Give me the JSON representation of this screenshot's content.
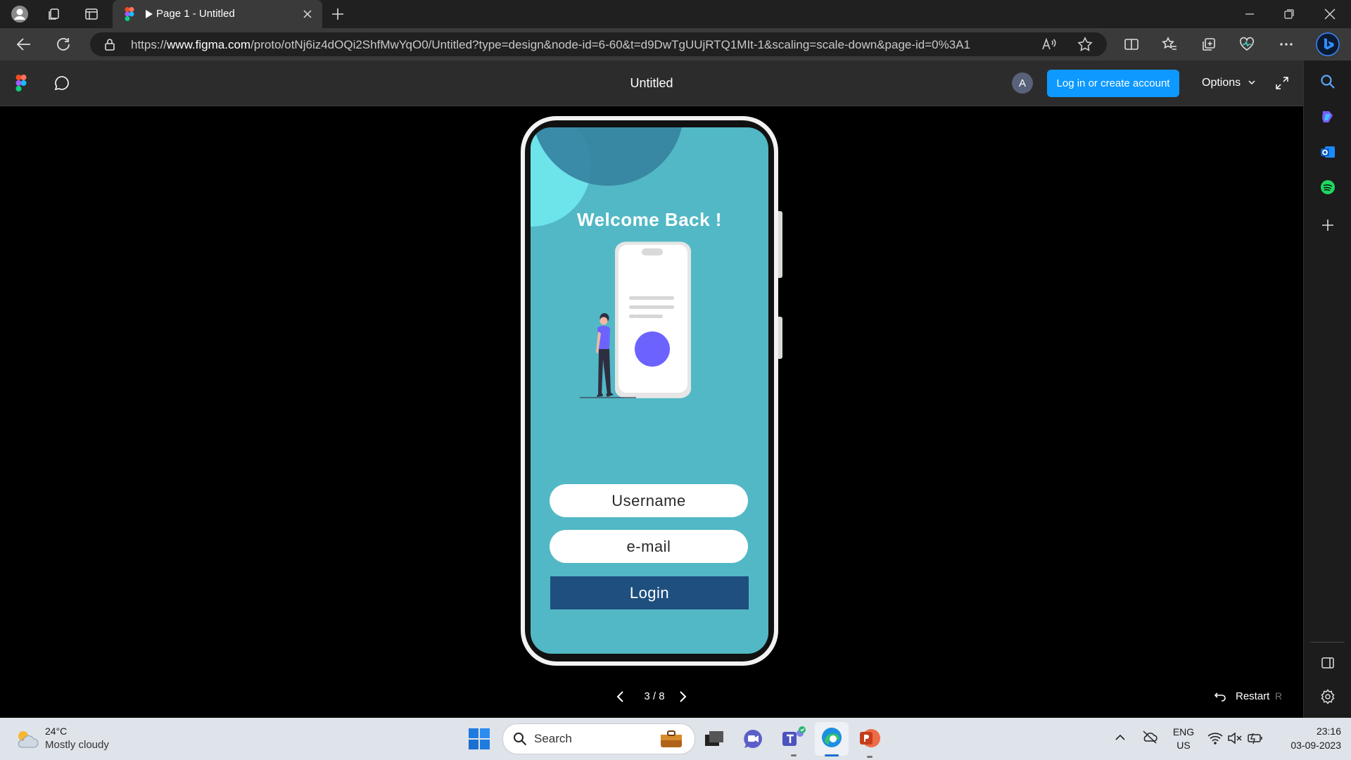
{
  "browser": {
    "tab_title": "Page 1 - Untitled",
    "url_prefix": "https://",
    "url_host": "www.figma.com",
    "url_path": "/proto/otNj6iz4dOQi2ShfMwYqO0/Untitled?type=design&node-id=6-60&t=d9DwTgUUjRTQ1MIt-1&scaling=scale-down&page-id=0%3A1"
  },
  "figma": {
    "file_title": "Untitled",
    "avatar_initial": "A",
    "login_label": "Log in or create account",
    "options_label": "Options"
  },
  "prototype": {
    "welcome": "Welcome Back !",
    "username_field": "Username",
    "email_field": "e-mail",
    "login_button": "Login",
    "check_mark": "✓"
  },
  "pager": {
    "current": "3 / 8",
    "restart_label": "Restart",
    "restart_key": "R"
  },
  "taskbar": {
    "temperature": "24°C",
    "weather": "Mostly cloudy",
    "search_placeholder": "Search",
    "lang_top": "ENG",
    "lang_bottom": "US",
    "time": "23:16",
    "date": "03-09-2023"
  },
  "colors": {
    "accent": "#0d99ff",
    "screen_bg": "#52b8c5",
    "login_bg": "#1e4f7e",
    "check_circle": "#6c63ff"
  },
  "icons": [
    "profile-icon",
    "collections-icon",
    "tab-actions-icon",
    "figma-favicon",
    "close-tab-icon",
    "new-tab-icon",
    "minimize-icon",
    "restore-icon",
    "close-window-icon",
    "back-icon",
    "refresh-icon",
    "lock-icon",
    "read-aloud-icon",
    "favorite-icon",
    "split-screen-icon",
    "favorites-icon",
    "collections-bar-icon",
    "performance-icon",
    "more-icon",
    "bing-icon",
    "figma-logo-icon",
    "comment-icon",
    "expand-icon",
    "search-icon",
    "copilot-icon",
    "outlook-icon",
    "spotify-icon",
    "add-icon",
    "sidebar-toggle-icon",
    "settings-icon"
  ]
}
